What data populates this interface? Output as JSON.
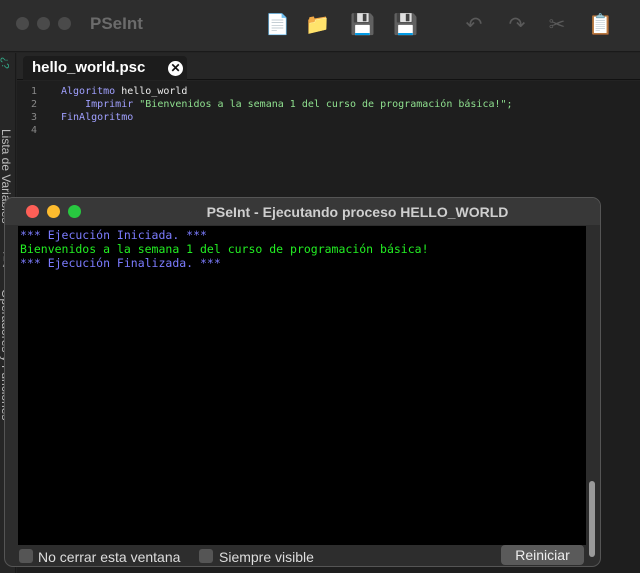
{
  "app": {
    "title": "PSeInt",
    "toolbar_icons": [
      "new-file-icon",
      "open-folder-icon",
      "save-icon",
      "save-as-icon",
      "undo-icon",
      "redo-icon",
      "cut-icon",
      "copy-icon"
    ]
  },
  "sidebar": {
    "variables_label": "Lista de Variables",
    "operators_label": "Operadores y Funciones",
    "var_icon_text": "¿?",
    "ops_icon_text": "*+=<"
  },
  "editor": {
    "tab": "hello_world.psc",
    "lines": [
      {
        "n": "1",
        "kw": "Algoritmo",
        "rest": " hello_world"
      },
      {
        "n": "2",
        "kw": "    Imprimir",
        "rest": " \"Bienvenidos a la semana 1 del curso de programación básica!\";"
      },
      {
        "n": "3",
        "kw": "FinAlgoritmo",
        "rest": ""
      },
      {
        "n": "4",
        "kw": "",
        "rest": ""
      }
    ]
  },
  "console": {
    "title": "PSeInt - Ejecutando proceso HELLO_WORLD",
    "output": [
      "*** Ejecución Iniciada. ***",
      "Bienvenidos a la semana 1 del curso de programación básica!",
      "*** Ejecución Finalizada. ***"
    ],
    "no_close_label": "No cerrar esta ventana",
    "always_visible_label": "Siempre visible",
    "restart_label": "Reiniciar"
  }
}
